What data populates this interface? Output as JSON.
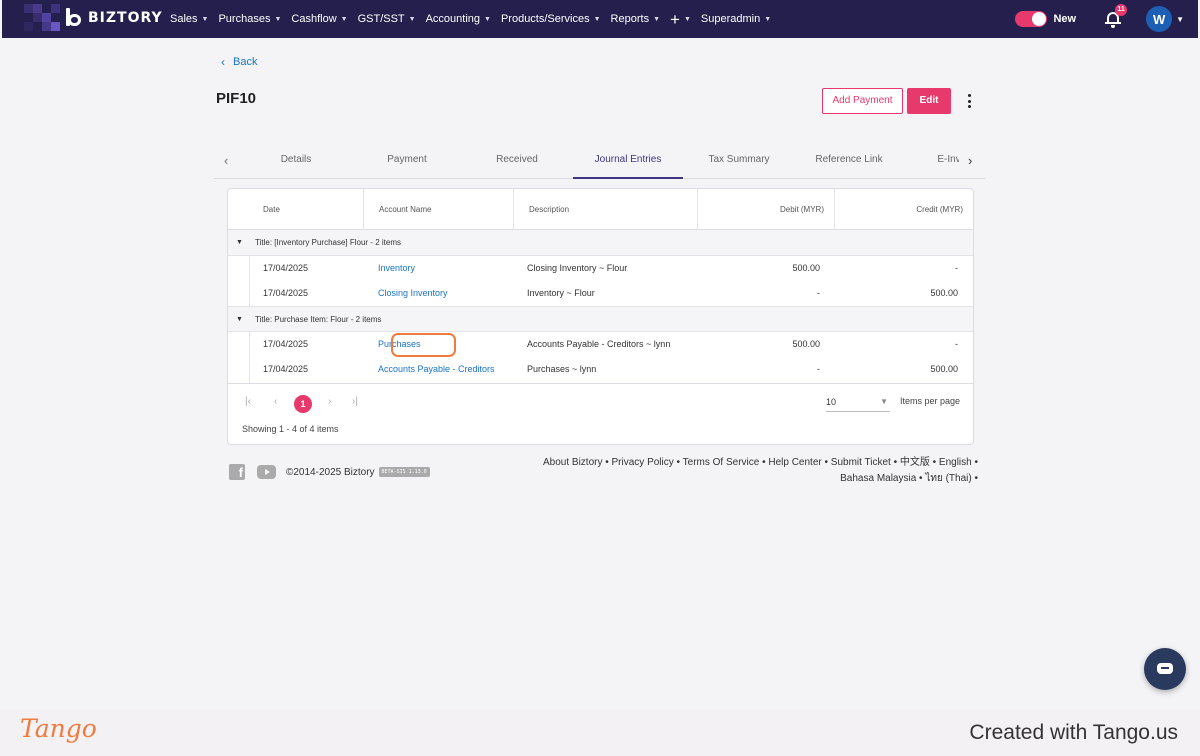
{
  "topnav": {
    "brand": "BIZTORY",
    "menu": [
      {
        "label": "Sales"
      },
      {
        "label": "Purchases"
      },
      {
        "label": "Cashflow"
      },
      {
        "label": "GST/SST"
      },
      {
        "label": "Accounting"
      },
      {
        "label": "Products/Services"
      },
      {
        "label": "Reports"
      },
      {
        "label": "+"
      },
      {
        "label": "Superadmin"
      }
    ],
    "toggle_label": "New",
    "toggle_on": true,
    "notification_count": "11",
    "avatar_initial": "W",
    "colors": {
      "bar": "#241f4d",
      "accent": "#e8396d",
      "avatar": "#1d5fb5"
    }
  },
  "page": {
    "back_label": "Back",
    "title": "PIF10",
    "add_payment_label": "Add Payment",
    "edit_label": "Edit"
  },
  "tabs": [
    {
      "label": "Details",
      "active": false
    },
    {
      "label": "Payment",
      "active": false
    },
    {
      "label": "Received",
      "active": false
    },
    {
      "label": "Journal Entries",
      "active": true
    },
    {
      "label": "Tax Summary",
      "active": false
    },
    {
      "label": "Reference Link",
      "active": false
    },
    {
      "label": "E-Inv",
      "active": false
    }
  ],
  "grid": {
    "columns": [
      "Date",
      "Account Name",
      "Description",
      "Debit (MYR)",
      "Credit (MYR)"
    ],
    "groups": [
      {
        "title": "Title: [Inventory Purchase] Flour - 2 items",
        "rows": [
          {
            "date": "17/04/2025",
            "account": "Inventory",
            "description": "Closing Inventory ~ Flour",
            "debit": "500.00",
            "credit": "-"
          },
          {
            "date": "17/04/2025",
            "account": "Closing Inventory",
            "description": "Inventory ~ Flour",
            "debit": "-",
            "credit": "500.00"
          }
        ]
      },
      {
        "title": "Title: Purchase Item: Flour - 2 items",
        "rows": [
          {
            "date": "17/04/2025",
            "account": "Purchases",
            "description": "Accounts Payable - Creditors ~ lynn",
            "debit": "500.00",
            "credit": "-"
          },
          {
            "date": "17/04/2025",
            "account": "Accounts Payable - Creditors",
            "description": "Purchases ~ lynn",
            "debit": "-",
            "credit": "500.00"
          }
        ]
      }
    ]
  },
  "pager": {
    "current_page": "1",
    "page_size": "10",
    "page_size_label": "Items per page",
    "info": "Showing 1 - 4 of 4 items"
  },
  "footer": {
    "copyright": "©2014-2025 Biztory",
    "version": "BETA-SIS 1.13.0",
    "links_line1": "About Biztory • Privacy Policy • Terms Of Service • Help Center • Submit Ticket • 中文版 • English •",
    "links_line2": "Bahasa Malaysia • ไทย (Thai) •"
  },
  "tango": {
    "logo": "Tango",
    "credit": "Created with Tango.us"
  }
}
